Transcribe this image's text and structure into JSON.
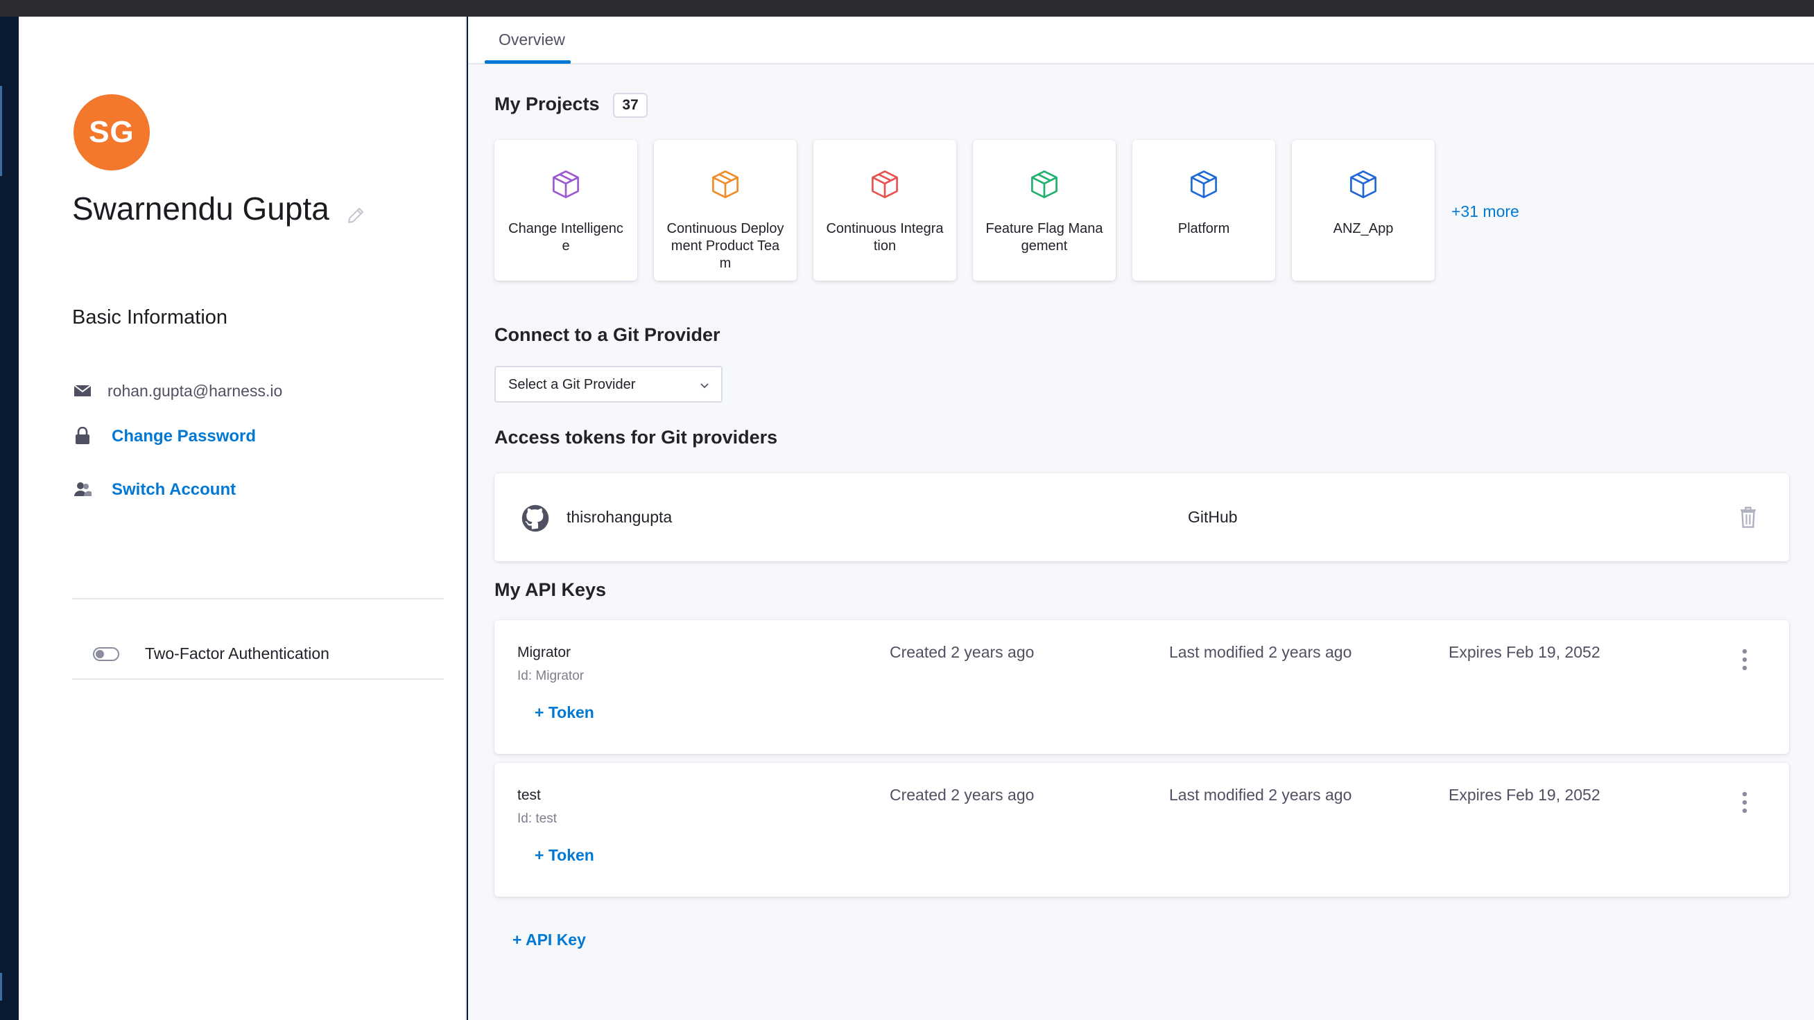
{
  "profile": {
    "initials": "SG",
    "name": "Swarnendu Gupta",
    "basic_info_title": "Basic Information",
    "email": "rohan.gupta@harness.io",
    "change_password": "Change Password",
    "switch_account": "Switch Account",
    "two_factor": "Two-Factor Authentication",
    "two_factor_enabled": false,
    "avatar_color": "#f3782c"
  },
  "tabs": [
    {
      "label": "Overview",
      "active": true
    }
  ],
  "projects": {
    "title": "My Projects",
    "count": "37",
    "items": [
      {
        "label": "Change Intelligence",
        "color": "#9b59d0",
        "icon": "cube-icon"
      },
      {
        "label": "Continuous Deployment Product Team",
        "color": "#f08c28",
        "icon": "cube-icon"
      },
      {
        "label": "Continuous Integration",
        "color": "#e8514f",
        "icon": "cube-icon"
      },
      {
        "label": "Feature Flag Management",
        "color": "#1fb06e",
        "icon": "cube-icon"
      },
      {
        "label": "Platform",
        "color": "#1f67d8",
        "icon": "cube-icon"
      },
      {
        "label": "ANZ_App",
        "color": "#1f67d8",
        "icon": "cube-icon"
      }
    ],
    "more": "+31 more"
  },
  "git": {
    "connect_title": "Connect to a Git Provider",
    "select_placeholder": "Select a Git Provider",
    "tokens_title": "Access tokens for Git providers",
    "tokens": [
      {
        "user": "thisrohangupta",
        "provider": "GitHub"
      }
    ]
  },
  "api_keys": {
    "title": "My API Keys",
    "items": [
      {
        "name": "Migrator",
        "id": "Id: Migrator",
        "created": "Created 2 years ago",
        "modified": "Last modified 2 years ago",
        "expires": "Expires Feb 19, 2052",
        "add_token": "+ Token"
      },
      {
        "name": "test",
        "id": "Id: test",
        "created": "Created 2 years ago",
        "modified": "Last modified 2 years ago",
        "expires": "Expires Feb 19, 2052",
        "add_token": "+ Token"
      }
    ],
    "add_key": "+ API Key"
  },
  "colors": {
    "accent": "#0278d5",
    "nav_bg": "#0b1a33"
  }
}
